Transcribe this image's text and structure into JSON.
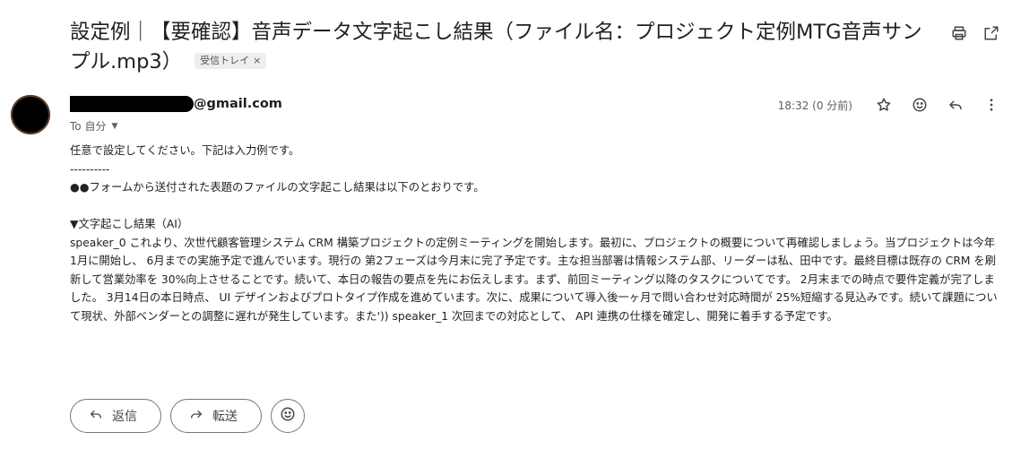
{
  "subject": {
    "text": "設定例｜【要確認】音声データ文字起こし結果（ファイル名：プロジェクト定例MTG音声サンプル.mp3）",
    "label": "受信トレイ",
    "label_close": "×"
  },
  "toolbar": {
    "print_icon": "print-icon",
    "popout_icon": "open-in-new-window-icon"
  },
  "sender": {
    "email_suffix": "@gmail.com",
    "to_text": "To 自分",
    "time": "18:32 (0 分前)"
  },
  "body": {
    "line1": "任意で設定してください。下記は入力例です。",
    "separator": "----------",
    "line2": "●●フォームから送付された表題のファイルの文字起こし結果は以下のとおりです。",
    "section_title": "▼文字起こし結果（AI）",
    "transcript": "speaker_0 これより、次世代顧客管理システム CRM 構築プロジェクトの定例ミーティングを開始します。最初に、プロジェクトの概要について再確認しましょう。当プロジェクトは今年 1月に開始し、 6月までの実施予定で進んでいます。現行の 第2フェーズは今月末に完了予定です。主な担当部署は情報システム部、リーダーは私、田中です。最終目標は既存の CRM を刷新して営業効率を 30%向上させることです。続いて、本日の報告の要点を先にお伝えします。まず、前回ミーティング以降のタスクについてです。 2月末までの時点で要件定義が完了しました。 3月14日の本日時点、 UI デザインおよびプロトタイプ作成を進めています。次に、成果について導入後一ヶ月で問い合わせ対応時間が 25%短縮する見込みです。続いて課題について現状、外部ベンダーとの調整に遅れが発生しています。また')) speaker_1 次回までの対応として、 API 連携の仕様を確定し、開発に着手する予定です。"
  },
  "actions": {
    "reply_label": "返信",
    "forward_label": "転送"
  }
}
